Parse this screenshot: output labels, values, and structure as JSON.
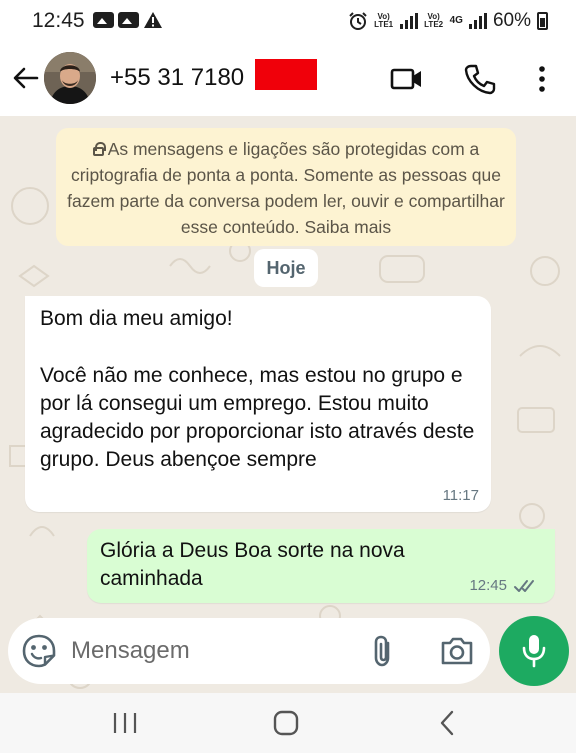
{
  "status_bar": {
    "time": "12:45",
    "sim1_label": "Vo) LTE1",
    "sim2_label": "Vo) LTE2",
    "network": "4G",
    "battery": "60%",
    "icons": [
      "gallery-icon",
      "gallery-icon",
      "warning-icon",
      "alarm-icon",
      "signal-icon",
      "battery-icon"
    ]
  },
  "header": {
    "contact": "+55 31 7180",
    "icons": [
      "back-arrow-icon",
      "video-call-icon",
      "phone-icon",
      "more-options-icon"
    ]
  },
  "chat": {
    "encryption_notice": "As mensagens e ligações são protegidas com a criptografia de ponta a ponta. Somente as pessoas que fazem parte da conversa podem ler, ouvir e compartilhar esse conteúdo.",
    "learn_more": "Saiba mais",
    "date_chip": "Hoje",
    "messages": [
      {
        "direction": "incoming",
        "text": "Bom dia meu amigo!\n\nVocê não me conhece, mas estou no grupo e por lá consegui um emprego. Estou muito agradecido por proporcionar isto através deste grupo. Deus abençoe sempre",
        "time": "11:17"
      },
      {
        "direction": "outgoing",
        "text": "Glória a Deus Boa sorte na nova caminhada",
        "time": "12:45",
        "status": "read"
      }
    ]
  },
  "composer": {
    "placeholder": "Mensagem",
    "icons": [
      "emoji-icon",
      "attach-icon",
      "camera-icon",
      "mic-icon"
    ]
  },
  "nav": {
    "icons": [
      "recents-icon",
      "home-icon",
      "back-icon"
    ]
  },
  "colors": {
    "chat_bg": "#efeae2",
    "incoming_bubble": "#ffffff",
    "outgoing_bubble": "#d9fdd3",
    "notice_bg": "#fdf3d2",
    "accent_green": "#1daa61",
    "redaction": "#f0000a"
  }
}
